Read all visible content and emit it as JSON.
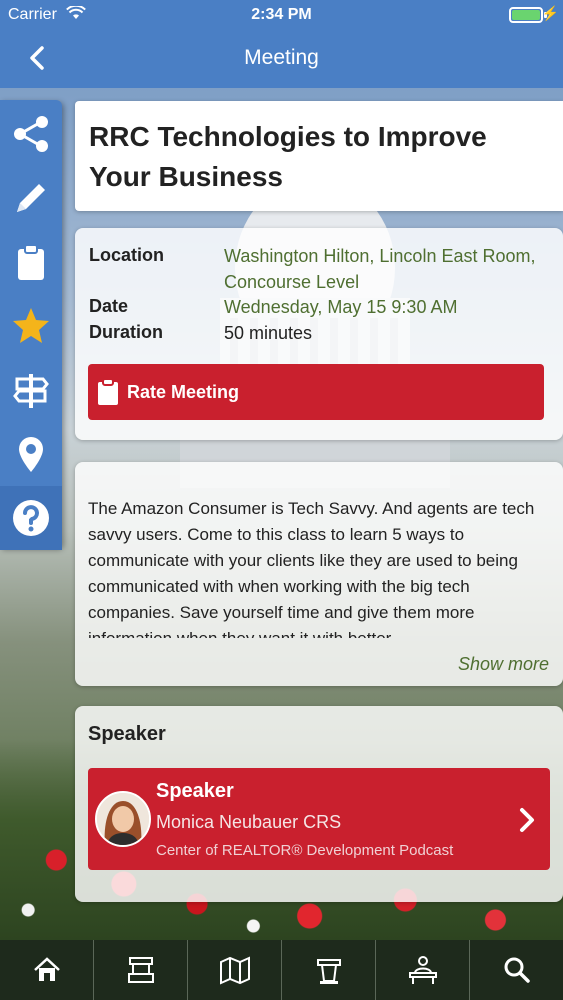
{
  "status_bar": {
    "carrier": "Carrier",
    "time": "2:34 PM"
  },
  "nav": {
    "title": "Meeting",
    "back_icon": "chevron-left-icon"
  },
  "sidebar": {
    "items": [
      {
        "icon": "share-icon"
      },
      {
        "icon": "pencil-icon"
      },
      {
        "icon": "clipboard-icon"
      },
      {
        "icon": "star-icon"
      },
      {
        "icon": "signpost-icon"
      },
      {
        "icon": "map-pin-icon"
      },
      {
        "icon": "help-icon"
      }
    ]
  },
  "meeting": {
    "title": "RRC Technologies to Improve Your Business",
    "location_label": "Location",
    "location_value": "Washington Hilton, Lincoln East Room, Concourse Level",
    "date_label": "Date",
    "date_value": "Wednesday, May 15 9:30 AM",
    "duration_label": "Duration",
    "duration_value": "50 minutes",
    "rate_button": "Rate Meeting",
    "description": "The Amazon Consumer is Tech Savvy.  And agents are tech savvy users.  Come to this class to learn 5 ways to communicate with your clients like they are used to being communicated with when working with the big tech companies.  Save yourself time and give them more information when they want it with better",
    "show_more": "Show more"
  },
  "speaker": {
    "heading": "Speaker",
    "role": "Speaker",
    "name": "Monica Neubauer CRS",
    "organization": "Center of REALTOR® Development Podcast"
  },
  "tabbar": {
    "items": [
      {
        "icon": "home-icon"
      },
      {
        "icon": "booth-icon"
      },
      {
        "icon": "map-icon"
      },
      {
        "icon": "podium-icon"
      },
      {
        "icon": "presenter-icon"
      },
      {
        "icon": "search-icon"
      }
    ]
  },
  "colors": {
    "brand_blue": "#4a7fc5",
    "accent_red": "#c9202e",
    "value_green": "#4f6f31",
    "tabbar": "#1e2a1c"
  }
}
